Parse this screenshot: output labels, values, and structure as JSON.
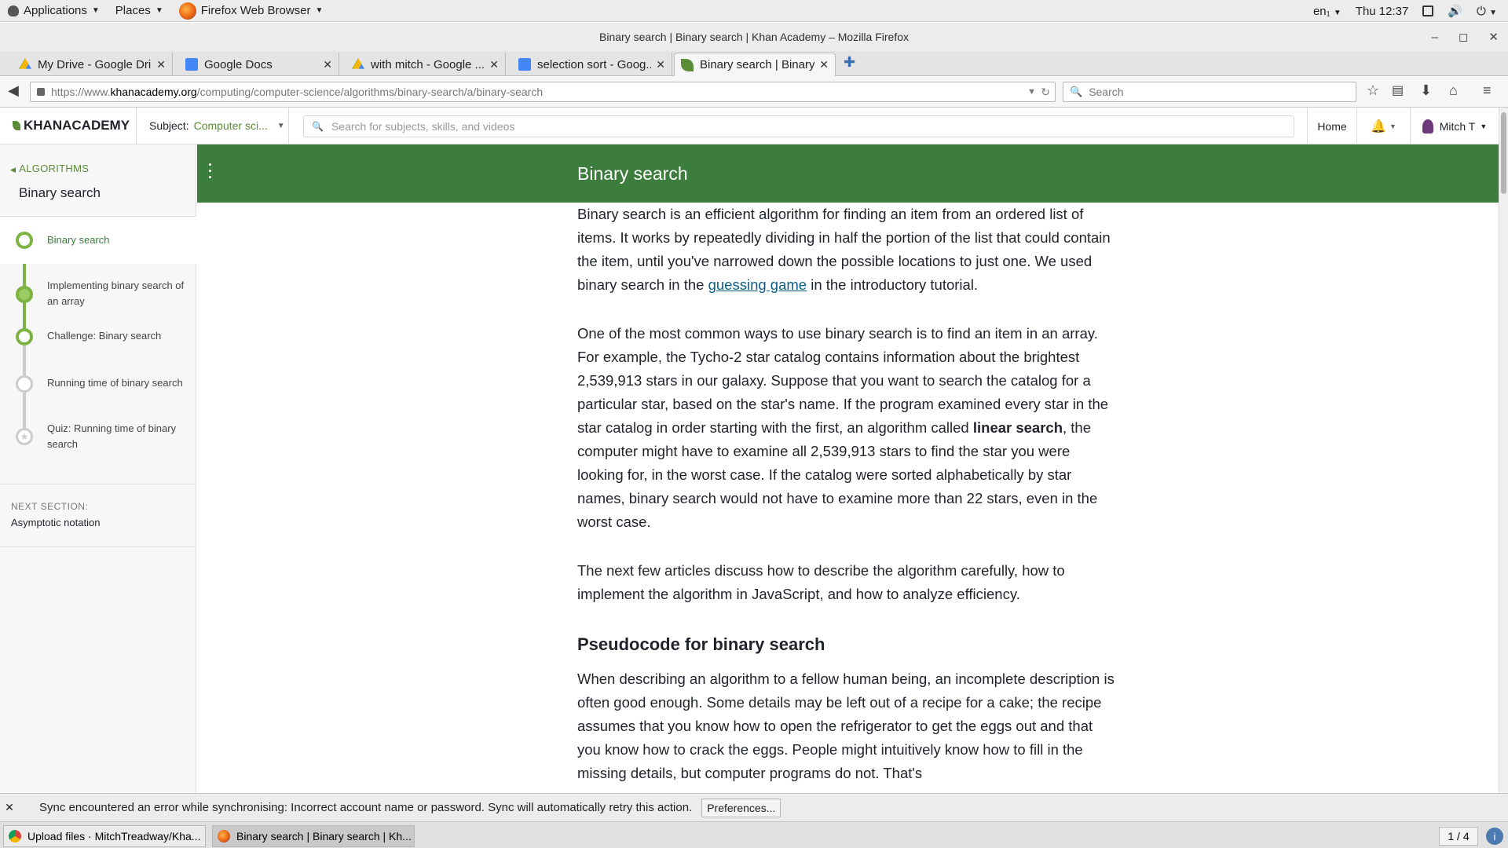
{
  "gnome": {
    "applications": "Applications",
    "places": "Places",
    "current_app": "Firefox Web Browser",
    "keyboard": "en₁",
    "clock": "Thu 12:37"
  },
  "window": {
    "title": "Binary search | Binary search | Khan Academy – Mozilla Firefox"
  },
  "tabs": [
    {
      "label": "My Drive - Google Dri...",
      "icon": "google-drive-icon"
    },
    {
      "label": "Google Docs",
      "icon": "google-docs-icon"
    },
    {
      "label": "with mitch - Google ...",
      "icon": "google-drive-icon"
    },
    {
      "label": "selection sort - Goog...",
      "icon": "google-docs-icon"
    },
    {
      "label": "Binary search | Binary...",
      "icon": "khan-leaf-icon"
    }
  ],
  "navbar": {
    "url_prefix": "https://www.",
    "url_host": "khanacademy.org",
    "url_path": "/computing/computer-science/algorithms/binary-search/a/binary-search",
    "search_placeholder": "Search"
  },
  "ka": {
    "logo": "KHANACADEMY",
    "subject_label": "Subject:",
    "subject_value": "Computer sci...",
    "search_placeholder": "Search for subjects, skills, and videos",
    "home": "Home",
    "user": "Mitch T"
  },
  "sidebar": {
    "back": "ALGORITHMS",
    "title": "Binary search",
    "items": [
      {
        "line1": "Binary search",
        "line2": "",
        "state": "active"
      },
      {
        "line1": "Implementing binary search of",
        "line2": "an array",
        "state": "done"
      },
      {
        "line1": "Challenge: Binary search",
        "line2": "",
        "state": "done"
      },
      {
        "line1": "Running time of binary search",
        "line2": "",
        "state": "todo"
      },
      {
        "line1": "Quiz: Running time of binary",
        "line2": "search",
        "state": "todo"
      }
    ],
    "next_label": "NEXT SECTION:",
    "next_value": "Asymptotic notation"
  },
  "article": {
    "banner_title": "Binary search",
    "p1_a": "Binary search is an efficient algorithm for finding an item from an ordered list of items. It works by repeatedly dividing in half the portion of the list that could contain the item, until you've narrowed down the possible locations to just one. We used binary search in the ",
    "p1_link": "guessing game",
    "p1_b": " in the introductory tutorial.",
    "p2_a": "One of the most common ways to use binary search is to find an item in an array. For example, the Tycho-2 star catalog contains information about the brightest 2,539,913 stars in our galaxy. Suppose that you want to search the catalog for a particular star, based on the star's name. If the program examined every star in the star catalog in order starting with the first, an algorithm called ",
    "p2_bold": "linear search",
    "p2_b": ", the computer might have to examine all 2,539,913 stars to find the star you were looking for, in the worst case. If the catalog were sorted alphabetically by star names, binary search would not have to examine more than 22 stars, even in the worst case.",
    "p3": "The next few articles discuss how to describe the algorithm carefully, how to implement the algorithm in JavaScript, and how to analyze efficiency.",
    "h2": "Pseudocode for binary search",
    "p4": "When describing an algorithm to a fellow human being, an incomplete description is often good enough. Some details may be left out of a recipe for a cake; the recipe assumes that you know how to open the refrigerator to get the eggs out and that you know how to crack the eggs. People might intuitively know how to fill in the missing details, but computer programs do not. That's"
  },
  "notification": {
    "message": "Sync encountered an error while synchronising: Incorrect account name or password. Sync will automatically retry this action.",
    "button": "Preferences..."
  },
  "taskbar": {
    "items": [
      {
        "label": "Upload files · MitchTreadway/Kha...",
        "icon": "chrome-icon"
      },
      {
        "label": "Binary search | Binary search | Kh...",
        "icon": "firefox-icon"
      }
    ],
    "pager": "1 / 4"
  },
  "colors": {
    "ka_green": "#3c7d3e",
    "ka_link_green": "#5b8c35",
    "link_blue": "#0b5e8a"
  }
}
